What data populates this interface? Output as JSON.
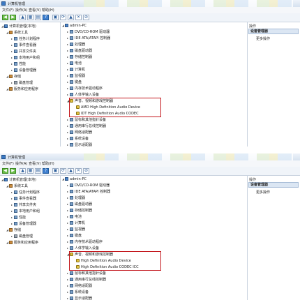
{
  "window": {
    "title": "计算机管理"
  },
  "menu": [
    "文件(F)",
    "操作(A)",
    "查看(V)",
    "帮助(H)"
  ],
  "left_tree": [
    {
      "label": "计算机管理(本地)",
      "icon": "computer-icon",
      "indent": 0
    },
    {
      "label": "系统工具",
      "icon": "tool-icon",
      "indent": 1
    },
    {
      "label": "任务计划程序",
      "icon": "clock-icon",
      "indent": 2
    },
    {
      "label": "事件查看器",
      "icon": "event-icon",
      "indent": 2
    },
    {
      "label": "共享文件夹",
      "icon": "folder-icon",
      "indent": 2
    },
    {
      "label": "本地用户和组",
      "icon": "users-icon",
      "indent": 2
    },
    {
      "label": "性能",
      "icon": "performance-icon",
      "indent": 2
    },
    {
      "label": "设备管理器",
      "icon": "device-manager-icon",
      "indent": 2
    },
    {
      "label": "存储",
      "icon": "storage-icon",
      "indent": 1
    },
    {
      "label": "磁盘管理",
      "icon": "disk-icon",
      "indent": 2
    },
    {
      "label": "服务和应用程序",
      "icon": "services-icon",
      "indent": 1
    }
  ],
  "device_tree_root": "admin-PC",
  "device_categories_top": [
    "DVD/CD-ROM 驱动器",
    "IDE ATA/ATAPI 控制器",
    "处理器",
    "磁盘驱动器",
    "存储控制器",
    "电池",
    "计算机",
    "监视器",
    "键盘",
    "内存技术驱动程序",
    "人体学输入设备",
    "声音、视频和游戏控制器"
  ],
  "device_categories_bottom": [
    "鼠标和其他指针设备",
    "通用串行总线控制器",
    "网络适配器",
    "系统设备",
    "显示适配器"
  ],
  "sound_children_panel1": [
    "AMD High Definition Audio Device",
    "IDT High Definition Audio CODEC"
  ],
  "sound_children_panel2": [
    "High Definition Audio Device",
    "High Definition Audio CODEC ICC"
  ],
  "actions": {
    "header": "操作",
    "selected": "设备管理器",
    "more": "更多操作"
  },
  "colors": {
    "highlight": "#c3161c",
    "selection": "#dbe6f3"
  }
}
